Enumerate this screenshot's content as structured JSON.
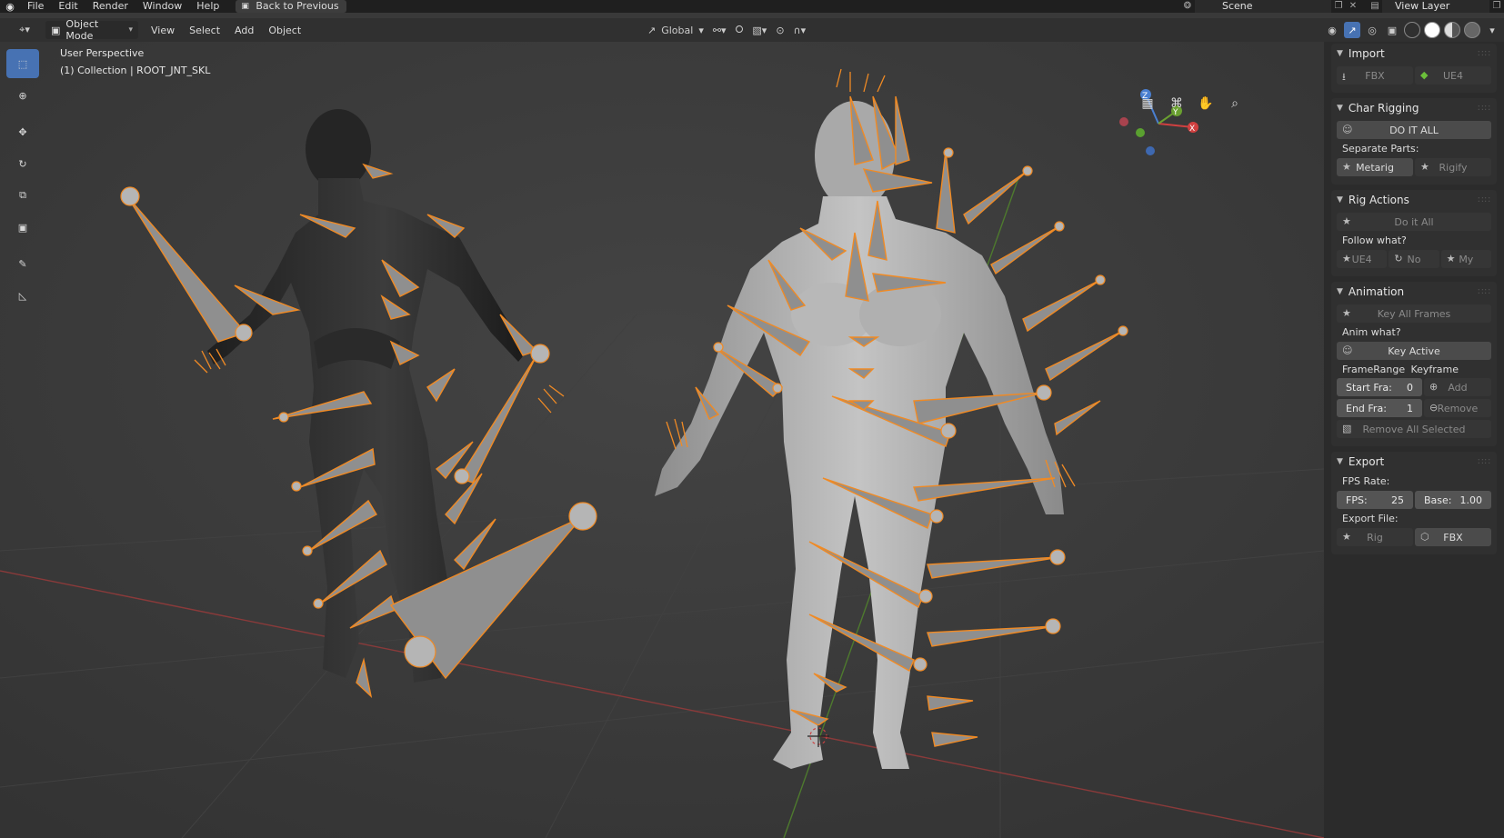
{
  "topbar": {
    "menu": [
      "File",
      "Edit",
      "Render",
      "Window",
      "Help"
    ],
    "back_button": "Back to Previous",
    "scene": "Scene",
    "view_layer": "View Layer"
  },
  "header": {
    "mode": "Object Mode",
    "menu": [
      "View",
      "Select",
      "Add",
      "Object"
    ],
    "orientation": "Global"
  },
  "viewport": {
    "perspective_label": "User Perspective",
    "collection_label": "(1) Collection | ROOT_JNT_SKL",
    "accent_color": "#f08a24",
    "gizmo": {
      "x": "X",
      "y": "Y",
      "z": "Z"
    }
  },
  "npanel": {
    "import": {
      "title": "Import",
      "fbx": "FBX",
      "ue4": "UE4"
    },
    "char_rigging": {
      "title": "Char Rigging",
      "do_it_all": "DO IT ALL",
      "separate_parts": "Separate Parts:",
      "metarig": "Metarig",
      "rigify": "Rigify"
    },
    "rig_actions": {
      "title": "Rig Actions",
      "do_it_all": "Do it All",
      "follow_what": "Follow what?",
      "ue4": "UE4",
      "no": "No",
      "my": "My"
    },
    "animation": {
      "title": "Animation",
      "key_all_frames": "Key All Frames",
      "anim_what": "Anim what?",
      "key_active": "Key Active",
      "frame_range": "FrameRange",
      "keyframe": "Keyframe",
      "start_label": "Start Fra:",
      "start_value": "0",
      "end_label": "End Fra:",
      "end_value": "1",
      "add": "Add",
      "remove": "Remove",
      "remove_all": "Remove All Selected"
    },
    "export": {
      "title": "Export",
      "fps_rate": "FPS Rate:",
      "fps_label": "FPS:",
      "fps_value": "25",
      "base_label": "Base:",
      "base_value": "1.00",
      "export_file": "Export File:",
      "rig": "Rig",
      "fbx": "FBX"
    }
  }
}
